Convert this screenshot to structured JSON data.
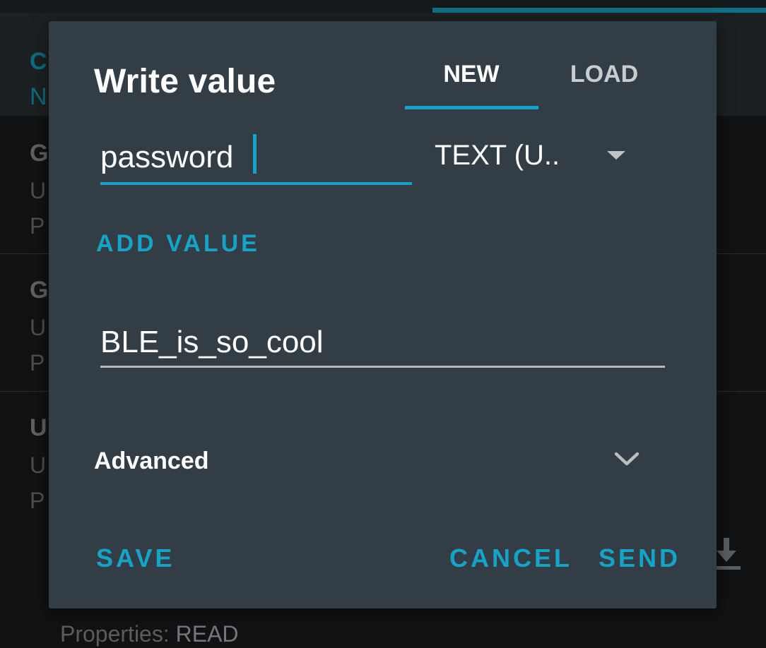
{
  "background": {
    "header_line1": "C",
    "header_line2": "N",
    "items": [
      {
        "title": "G",
        "line1": "U",
        "line2": "P"
      },
      {
        "title": "G",
        "line1": "U",
        "line2": "P"
      },
      {
        "title": "U",
        "line1": "U",
        "line2": "P"
      }
    ],
    "properties_label": "Properties:",
    "properties_value": "READ"
  },
  "dialog": {
    "title": "Write value",
    "tabs": [
      {
        "label": "NEW",
        "active": true
      },
      {
        "label": "LOAD",
        "active": false
      }
    ],
    "name_input_value": "password",
    "type_select_value": "TEXT (U..",
    "add_value_label": "ADD VALUE",
    "value_input_value": "BLE_is_so_cool",
    "advanced_label": "Advanced",
    "buttons": {
      "save": "SAVE",
      "cancel": "CANCEL",
      "send": "SEND"
    }
  },
  "colors": {
    "accent": "#13a4c7",
    "dialog_bg": "#333d45",
    "text_primary": "#ffffff"
  },
  "icons": [
    "dropdown-arrow-icon",
    "chevron-down-icon",
    "overflow-menu-icon",
    "download-icon"
  ]
}
